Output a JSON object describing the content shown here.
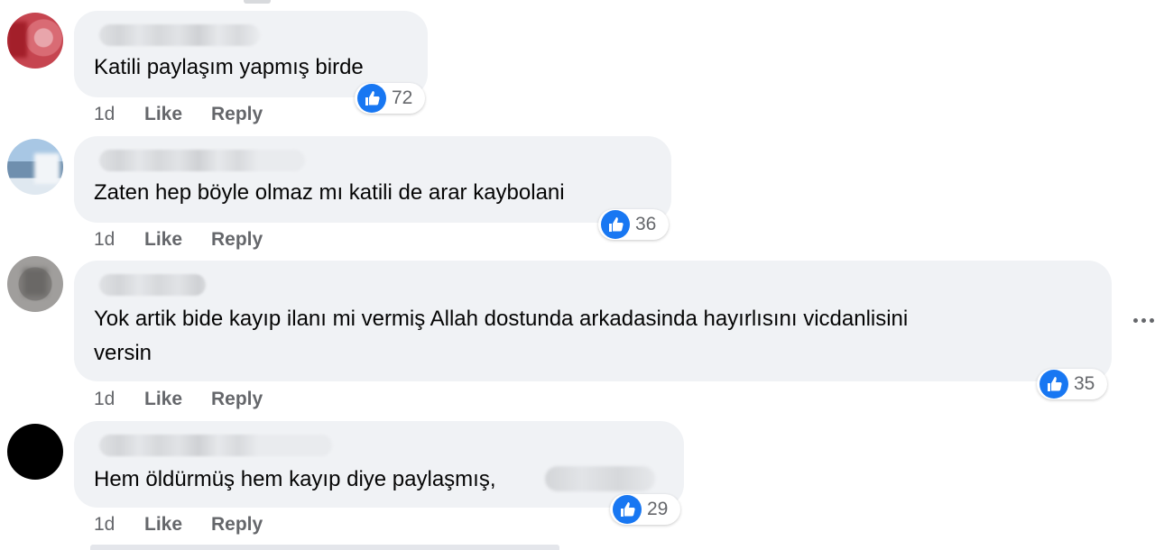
{
  "comments": [
    {
      "text_lines": [
        "Katili paylaşım yapmış birde"
      ],
      "reaction_count": "72",
      "time": "1d",
      "like_label": "Like",
      "reply_label": "Reply",
      "avatar_color": "#c64550"
    },
    {
      "text_lines": [
        "Zaten hep böyle olmaz mı katili de arar kaybolani"
      ],
      "reaction_count": "36",
      "time": "1d",
      "like_label": "Like",
      "reply_label": "Reply",
      "avatar_color": "#8fb3d4"
    },
    {
      "text_lines": [
        "Yok artik bide kayıp ilanı mi vermiş Allah dostunda arkadasinda hayırlısını vicdanlisini",
        "versin"
      ],
      "reaction_count": "35",
      "time": "1d",
      "like_label": "Like",
      "reply_label": "Reply",
      "avatar_color": "#8a8886"
    },
    {
      "text_lines": [
        "Hem öldürmüş hem kayıp diye paylaşmış,"
      ],
      "reaction_count": "29",
      "time": "1d",
      "like_label": "Like",
      "reply_label": "Reply",
      "avatar_color": "#000000"
    }
  ],
  "colors": {
    "bubble": "#f0f2f5",
    "like_blue": "#1877f2",
    "secondary_text": "#65676b",
    "primary_text": "#050505"
  },
  "icons": {
    "reaction": "thumbs-up-icon",
    "more": "more-options-icon"
  }
}
